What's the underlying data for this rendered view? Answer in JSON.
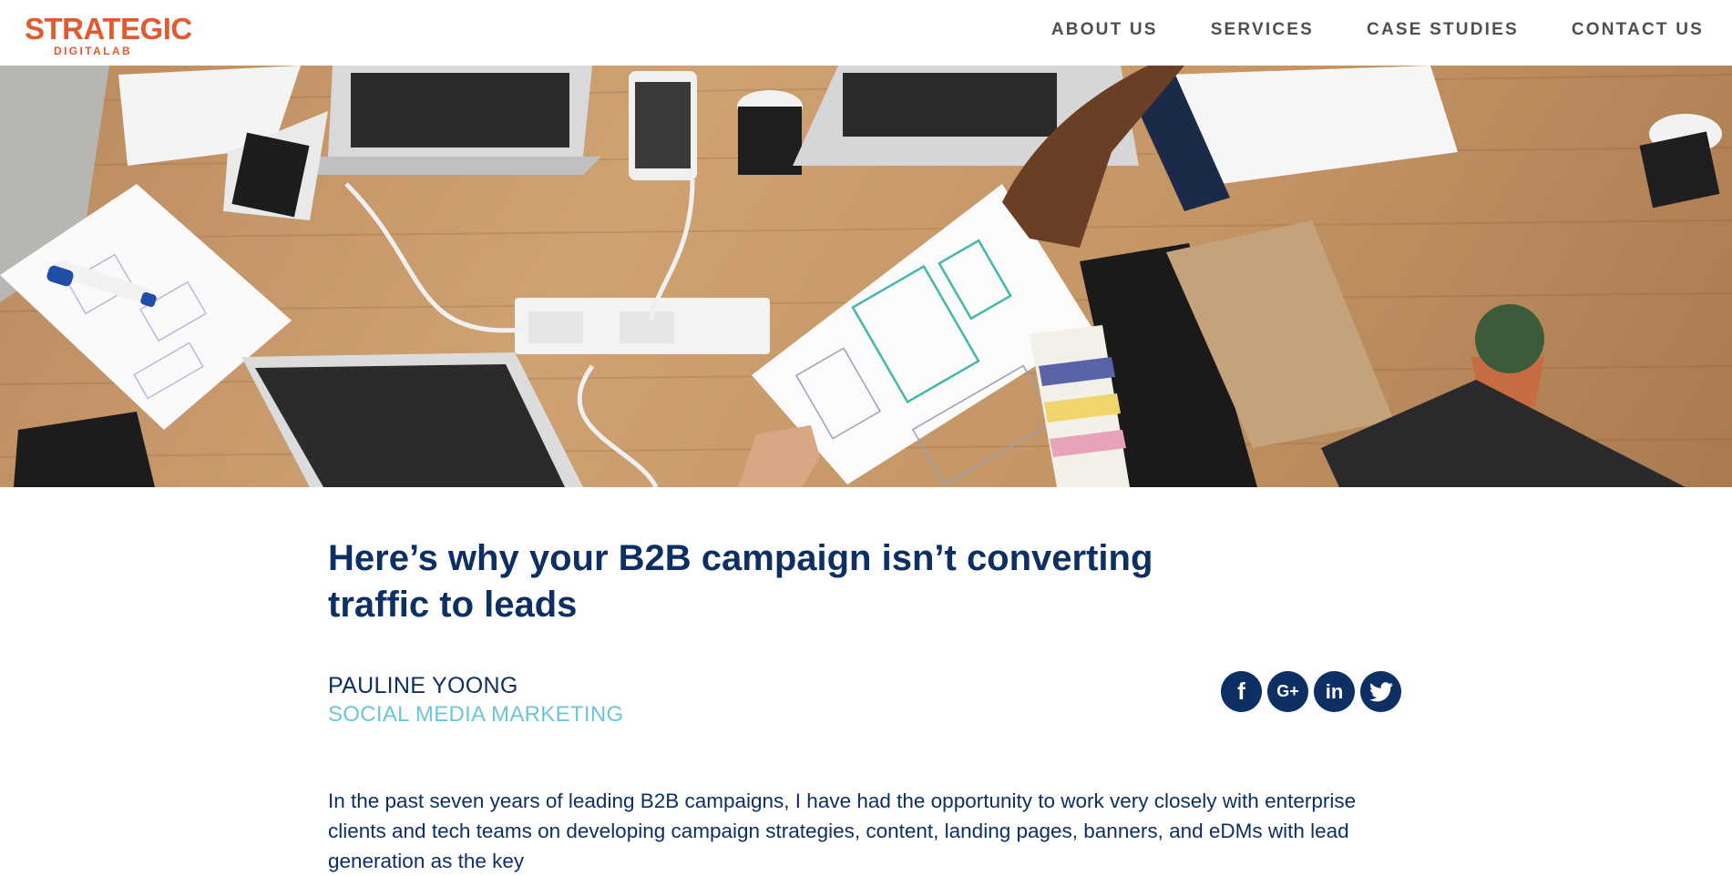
{
  "brand": {
    "logo_main": "STRATEGIC",
    "logo_sub": "DIGITALAB",
    "color": "#e15a30"
  },
  "nav": {
    "items": [
      {
        "label": "ABOUT US"
      },
      {
        "label": "SERVICES"
      },
      {
        "label": "CASE STUDIES"
      },
      {
        "label": "CONTACT US"
      }
    ]
  },
  "hero": {
    "icon": "office-desk-photo"
  },
  "article": {
    "title": "Here’s why your B2B campaign isn’t converting traffic to leads",
    "author": "PAULINE YOONG",
    "category": "SOCIAL MEDIA MARKETING",
    "body": "In the past seven years of leading B2B campaigns, I have had the opportunity to work very closely with enterprise clients and tech teams on developing campaign strategies, content, landing pages, banners, and eDMs with lead generation as the key"
  },
  "social": [
    {
      "name": "facebook-icon",
      "glyph": "f"
    },
    {
      "name": "google-plus-icon",
      "glyph": "G+"
    },
    {
      "name": "linkedin-icon",
      "glyph": "in"
    },
    {
      "name": "twitter-icon",
      "glyph": "t"
    }
  ],
  "colors": {
    "navy": "#0e2f63",
    "teal": "#6cc6da",
    "nav_text": "#4f4f4f"
  }
}
